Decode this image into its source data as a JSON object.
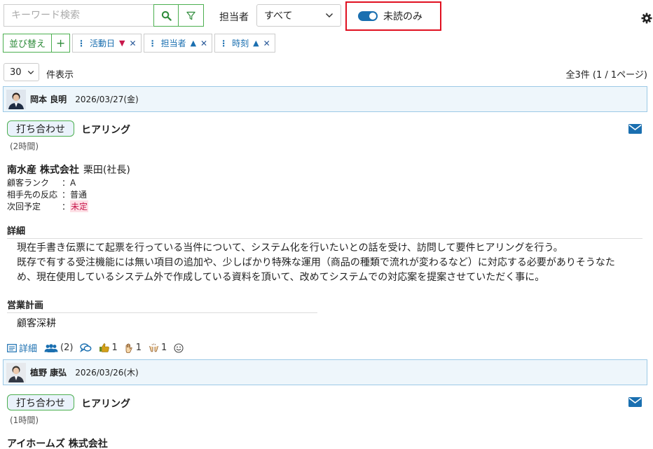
{
  "search": {
    "placeholder": "キーワード検索"
  },
  "filter": {
    "assignee_label": "担当者",
    "assignee_value": "すべて",
    "unread_label": "未読のみ"
  },
  "sort": {
    "button_label": "並び替え",
    "add_label": "+",
    "chips": [
      {
        "label": "活動日",
        "dir": "▼"
      },
      {
        "label": "担当者",
        "dir": "▲"
      },
      {
        "label": "時刻",
        "dir": "▲"
      }
    ]
  },
  "paging": {
    "per_page": "30",
    "per_page_label": "件表示",
    "total": "全3件 (1 / 1ページ)"
  },
  "records": [
    {
      "user": "岡本 良明",
      "date": "2026/03/27(金)",
      "type": "打ち合わせ",
      "title": "ヒアリング",
      "duration": "(2時間)",
      "company": "南水産 株式会社",
      "person": "栗田(社長)",
      "fields": [
        {
          "k": "顧客ランク",
          "v": "：A"
        },
        {
          "k": "相手先の反応",
          "v": "：普通"
        },
        {
          "k": "次回予定",
          "v_prefix": "：",
          "v": "未定"
        }
      ],
      "detail_title": "詳細",
      "detail_lines": [
        "現在手書き伝票にて起票を行っている当件について、システム化を行いたいとの話を受け、訪問して要件ヒアリングを行う。",
        "既存で有する受注機能には無い項目の追加や、少しばかり特殊な運用（商品の種類で流れが変わるなど）に対応する必要がありそうなた",
        "め、現在使用しているシステム外で作成している資料を頂いて、改めてシステムでの対応案を提案させていただく事に。"
      ],
      "plan_title": "営業計画",
      "plan_text": "顧客深耕",
      "actions": {
        "detail_label": "詳細",
        "participants": "(2)",
        "reactions": [
          "1",
          "1",
          "1"
        ]
      }
    },
    {
      "user": "植野 康弘",
      "date": "2026/03/26(木)",
      "type": "打ち合わせ",
      "title": "ヒアリング",
      "duration": "(1時間)",
      "company": "アイホームズ 株式会社"
    }
  ]
}
